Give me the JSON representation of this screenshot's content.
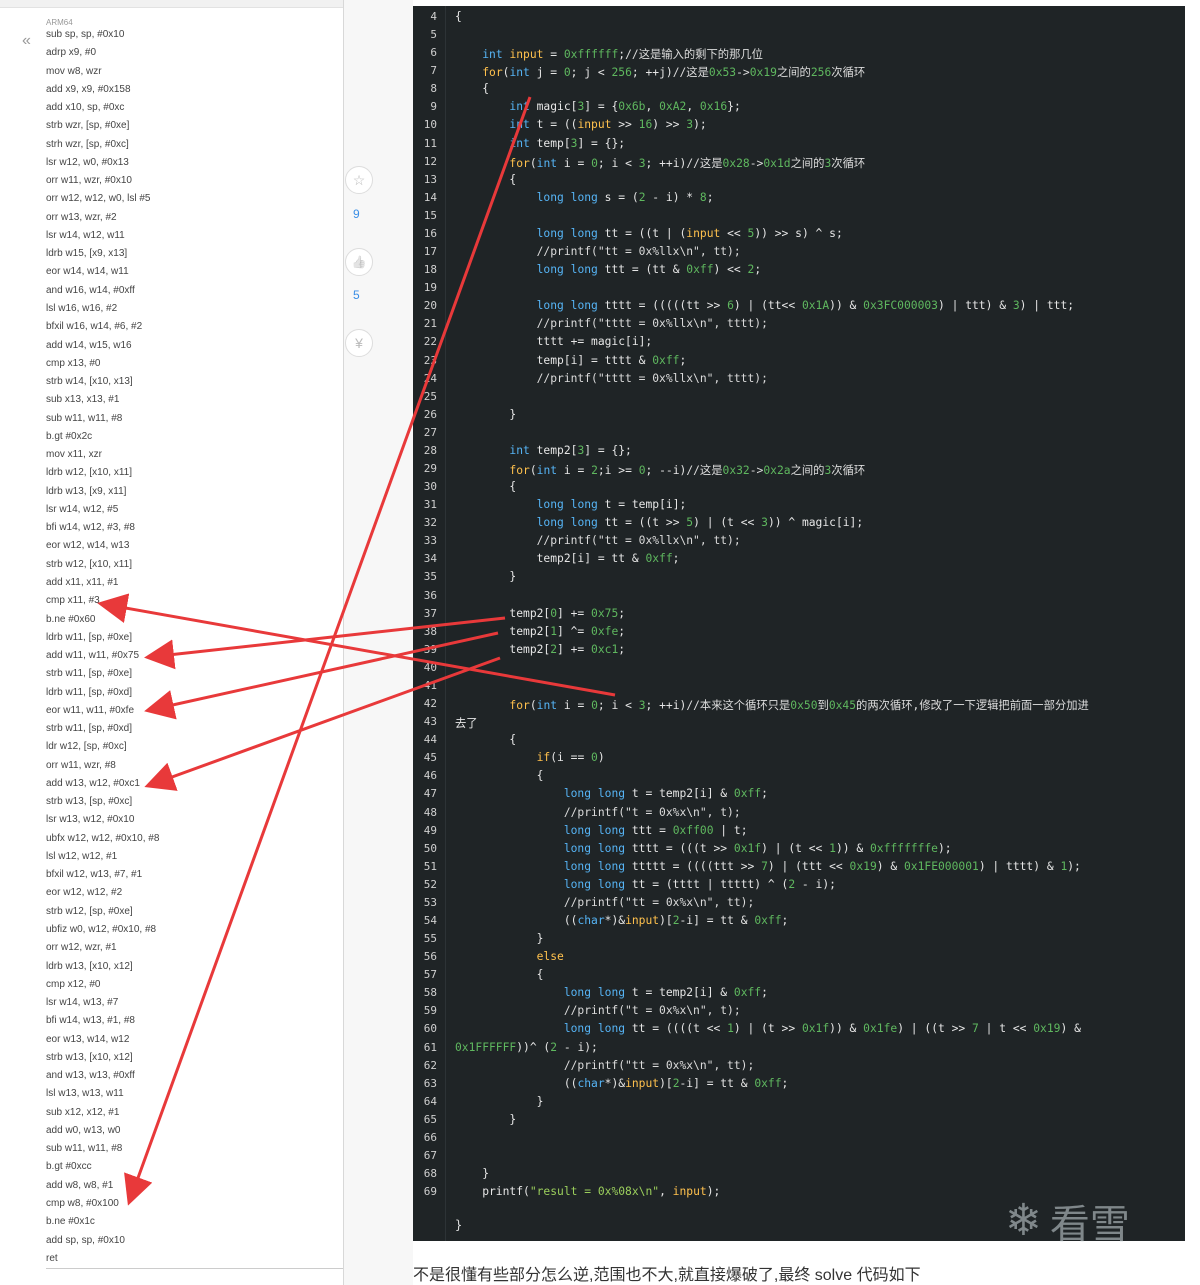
{
  "asm": {
    "arch": "ARM64",
    "collapse_icon": "«",
    "lines": [
      "sub sp, sp, #0x10",
      "adrp x9, #0",
      "mov w8, wzr",
      "add x9, x9, #0x158",
      "add x10, sp, #0xc",
      "strb wzr, [sp, #0xe]",
      "strh wzr, [sp, #0xc]",
      "lsr w12, w0, #0x13",
      "orr w11, wzr, #0x10",
      "orr w12, w12, w0, lsl #5",
      "orr w13, wzr, #2",
      "lsr w14, w12, w11",
      "ldrb w15, [x9, x13]",
      "eor w14, w14, w11",
      "and w16, w14, #0xff",
      "lsl w16, w16, #2",
      "bfxil w16, w14, #6, #2",
      "add w14, w15, w16",
      "cmp x13, #0",
      "strb w14, [x10, x13]",
      "sub x13, x13, #1",
      "sub w11, w11, #8",
      "b.gt #0x2c",
      "mov x11, xzr",
      "ldrb w12, [x10, x11]",
      "ldrb w13, [x9, x11]",
      "lsr w14, w12, #5",
      "bfi w14, w12, #3, #8",
      "eor w12, w14, w13",
      "strb w12, [x10, x11]",
      "add x11, x11, #1",
      "cmp x11, #3",
      "b.ne #0x60",
      "ldrb w11, [sp, #0xe]",
      "add w11, w11, #0x75",
      "strb w11, [sp, #0xe]",
      "ldrb w11, [sp, #0xd]",
      "eor w11, w11, #0xfe",
      "strb w11, [sp, #0xd]",
      "ldr w12, [sp, #0xc]",
      "orr w11, wzr, #8",
      "add w13, w12, #0xc1",
      "strb w13, [sp, #0xc]",
      "lsr w13, w12, #0x10",
      "ubfx w12, w12, #0x10, #8",
      "lsl w12, w12, #1",
      "bfxil w12, w13, #7, #1",
      "eor w12, w12, #2",
      "strb w12, [sp, #0xe]",
      "ubfiz w0, w12, #0x10, #8",
      "orr w12, wzr, #1",
      "ldrb w13, [x10, x12]",
      "cmp x12, #0",
      "lsr w14, w13, #7",
      "bfi w14, w13, #1, #8",
      "eor w13, w14, w12",
      "strb w13, [x10, x12]",
      "and w13, w13, #0xff",
      "lsl w13, w13, w11",
      "sub x12, x12, #1",
      "add w0, w13, w0",
      "sub w11, w11, #8",
      "b.gt #0xcc",
      "add w8, w8, #1",
      "cmp w8, #0x100",
      "b.ne #0x1c",
      "add sp, sp, #0x10",
      "ret"
    ]
  },
  "sidebar": {
    "star_icon": "☆",
    "star_count": "9",
    "like_icon": "👍",
    "like_count": "5",
    "reward_icon": "¥"
  },
  "code": {
    "first_line_brace": "{",
    "lines": [
      {
        "n": "4",
        "t": "{"
      },
      {
        "n": "5",
        "t": ""
      },
      {
        "n": "6",
        "t": "    int input = 0xffffff;//这是输入的剩下的那几位"
      },
      {
        "n": "7",
        "t": "    for(int j = 0; j < 256; ++j)//这是0x53->0x19之间的256次循环"
      },
      {
        "n": "8",
        "t": "    {"
      },
      {
        "n": "9",
        "t": "        int magic[3] = {0x6b, 0xA2, 0x16};"
      },
      {
        "n": "10",
        "t": "        int t = ((input >> 16) >> 3);"
      },
      {
        "n": "11",
        "t": "        int temp[3] = {};"
      },
      {
        "n": "12",
        "t": "        for(int i = 0; i < 3; ++i)//这是0x28->0x1d之间的3次循环"
      },
      {
        "n": "13",
        "t": "        {"
      },
      {
        "n": "14",
        "t": "            long long s = (2 - i) * 8;"
      },
      {
        "n": "15",
        "t": ""
      },
      {
        "n": "16",
        "t": "            long long tt = ((t | (input << 5)) >> s) ^ s;"
      },
      {
        "n": "17",
        "t": "            //printf(\"tt = 0x%llx\\n\", tt);"
      },
      {
        "n": "18",
        "t": "            long long ttt = (tt & 0xff) << 2;"
      },
      {
        "n": "19",
        "t": ""
      },
      {
        "n": "20",
        "t": "            long long tttt = (((((tt >> 6) | (tt<< 0x1A)) & 0x3FC000003) | ttt) & 3) | ttt;"
      },
      {
        "n": "21",
        "t": "            //printf(\"tttt = 0x%llx\\n\", tttt);"
      },
      {
        "n": "22",
        "t": "            tttt += magic[i];"
      },
      {
        "n": "23",
        "t": "            temp[i] = tttt & 0xff;"
      },
      {
        "n": "24",
        "t": "            //printf(\"tttt = 0x%llx\\n\", tttt);"
      },
      {
        "n": "25",
        "t": ""
      },
      {
        "n": "26",
        "t": "        }"
      },
      {
        "n": "27",
        "t": ""
      },
      {
        "n": "28",
        "t": "        int temp2[3] = {};"
      },
      {
        "n": "29",
        "t": "        for(int i = 2;i >= 0; --i)//这是0x32->0x2a之间的3次循环"
      },
      {
        "n": "30",
        "t": "        {"
      },
      {
        "n": "31",
        "t": "            long long t = temp[i];"
      },
      {
        "n": "32",
        "t": "            long long tt = ((t >> 5) | (t << 3)) ^ magic[i];"
      },
      {
        "n": "33",
        "t": "            //printf(\"tt = 0x%llx\\n\", tt);"
      },
      {
        "n": "34",
        "t": "            temp2[i] = tt & 0xff;"
      },
      {
        "n": "35",
        "t": "        }"
      },
      {
        "n": "36",
        "t": ""
      },
      {
        "n": "37",
        "t": "        temp2[0] += 0x75;"
      },
      {
        "n": "38",
        "t": "        temp2[1] ^= 0xfe;"
      },
      {
        "n": "39",
        "t": "        temp2[2] += 0xc1;"
      },
      {
        "n": "40",
        "t": ""
      },
      {
        "n": "41",
        "t": ""
      },
      {
        "n": "42",
        "t": "        for(int i = 0; i < 3; ++i)//本来这个循环只是0x50到0x45的两次循环,修改了一下逻辑把前面一部分加进"
      },
      {
        "n": "43",
        "t": "去了"
      },
      {
        "n": "44",
        "t": "        {"
      },
      {
        "n": "45",
        "t": "            if(i == 0)"
      },
      {
        "n": "46",
        "t": "            {"
      },
      {
        "n": "47",
        "t": "                long long t = temp2[i] & 0xff;"
      },
      {
        "n": "48",
        "t": "                //printf(\"t = 0x%x\\n\", t);"
      },
      {
        "n": "49",
        "t": "                long long ttt = 0xff00 | t;"
      },
      {
        "n": "50",
        "t": "                long long tttt = (((t >> 0x1f) | (t << 1)) & 0xfffffffe);"
      },
      {
        "n": "51",
        "t": "                long long ttttt = ((((ttt >> 7) | (ttt << 0x19) & 0x1FE000001) | tttt) & 1);"
      },
      {
        "n": "52",
        "t": "                long long tt = (tttt | ttttt) ^ (2 - i);"
      },
      {
        "n": "53",
        "t": "                //printf(\"tt = 0x%x\\n\", tt);"
      },
      {
        "n": "54",
        "t": "                ((char*)&input)[2-i] = tt & 0xff;"
      },
      {
        "n": "55",
        "t": "            }"
      },
      {
        "n": "56",
        "t": "            else"
      },
      {
        "n": "57",
        "t": "            {"
      },
      {
        "n": "58",
        "t": "                long long t = temp2[i] & 0xff;"
      },
      {
        "n": "59",
        "t": "                //printf(\"t = 0x%x\\n\", t);"
      },
      {
        "n": "60",
        "t": "                long long tt = ((((t << 1) | (t >> 0x1f)) & 0x1fe) | ((t >> 7 | t << 0x19) &"
      },
      {
        "n": "61",
        "t": "0x1FFFFFF))^ (2 - i);"
      },
      {
        "n": "62",
        "t": "                //printf(\"tt = 0x%x\\n\", tt);"
      },
      {
        "n": "63",
        "t": "                ((char*)&input)[2-i] = tt & 0xff;"
      },
      {
        "n": "64",
        "t": "            }"
      },
      {
        "n": "65",
        "t": "        }"
      },
      {
        "n": "66",
        "t": ""
      },
      {
        "n": "67",
        "t": ""
      },
      {
        "n": "68",
        "t": "    }"
      },
      {
        "n": "69",
        "t": "    printf(\"result = 0x%08x\\n\", input);"
      }
    ],
    "closing": "}"
  },
  "watermark": {
    "icon": "❄",
    "text": "看雪"
  },
  "footer": {
    "text": "不是很懂有些部分怎么逆,范围也不大,就直接爆破了,最终 solve 代码如下"
  },
  "colors": {
    "code_bg": "#1f2426",
    "arrow": "#e8393a",
    "keyword": "#56b4f5",
    "type": "#ffc14d",
    "number": "#5fb85f"
  }
}
